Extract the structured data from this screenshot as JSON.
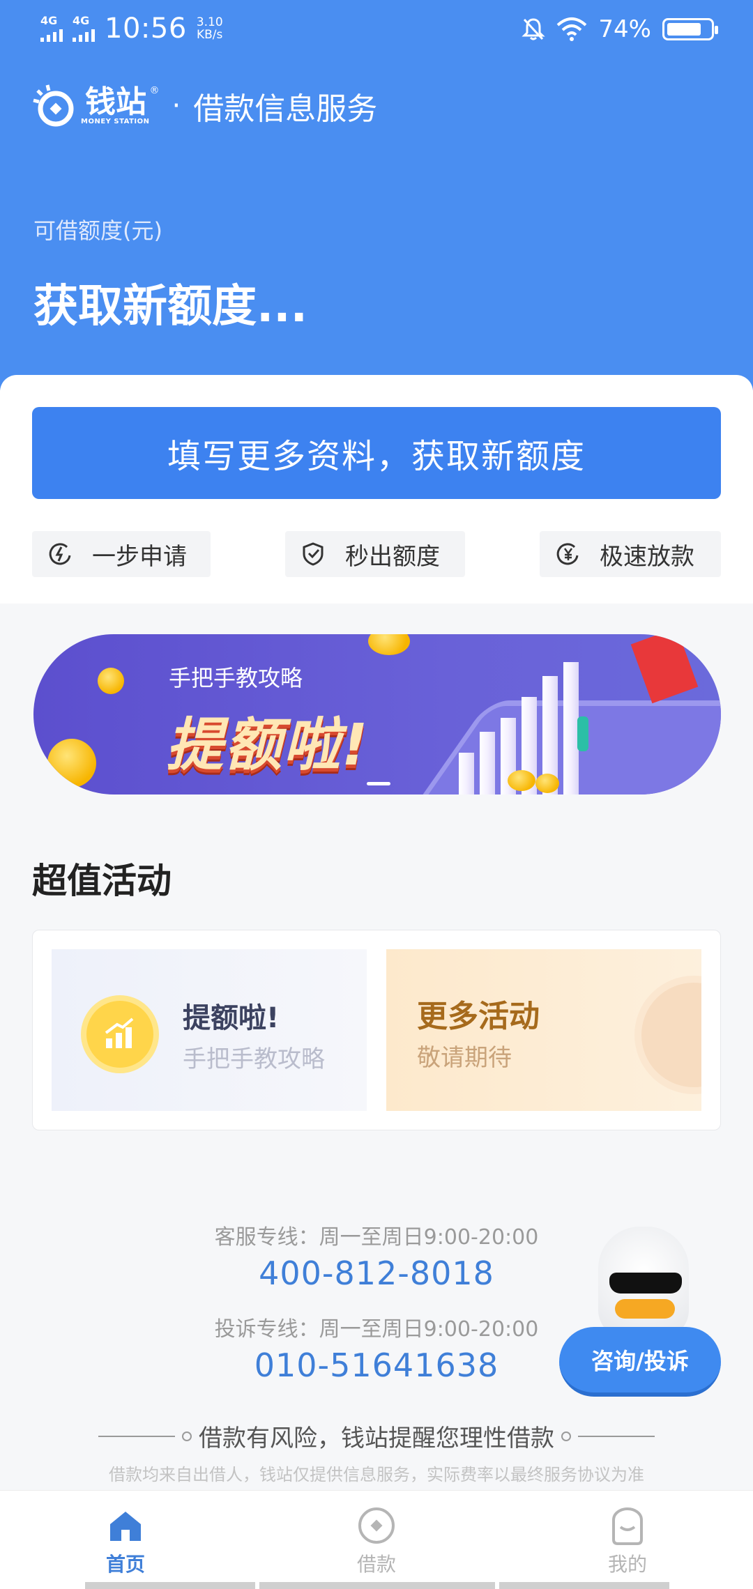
{
  "status_bar": {
    "net1": "4G",
    "net2": "4G",
    "time": "10:56",
    "speed_value": "3.10",
    "speed_unit": "KB/s",
    "battery": "74%",
    "battery_level": 0.74
  },
  "header": {
    "brand_name": "钱站",
    "brand_sub": "MONEY STATION",
    "brand_reg": "®",
    "separator": "·",
    "title": "借款信息服务",
    "quota_label": "可借额度(元)",
    "quota_value": "获取新额度..."
  },
  "main_button": "填写更多资料，获取新额度",
  "features": [
    {
      "label": "一步申请",
      "icon": "lightning-circle-icon"
    },
    {
      "label": "秒出额度",
      "icon": "check-shield-icon"
    },
    {
      "label": "极速放款",
      "icon": "yuan-circle-icon"
    }
  ],
  "banner": {
    "subtitle": "手把手教攻略",
    "title": "提额啦!"
  },
  "activities": {
    "title": "超值活动",
    "items": [
      {
        "title": "提额啦!",
        "subtitle": "手把手教攻略"
      },
      {
        "title": "更多活动",
        "subtitle": "敬请期待"
      }
    ]
  },
  "service": {
    "line1_label": "客服专线：周一至周日9:00-20:00",
    "line1_number": "400-812-8018",
    "line2_label": "投诉专线：周一至周日9:00-20:00",
    "line2_number": "010-51641638",
    "risk_notice": "借款有风险，钱站提醒您理性借款",
    "disclaimer": "借款均来自出借人，钱站仅提供信息服务，实际费率以最终服务协议为准"
  },
  "mascot": {
    "label": "咨询/投诉"
  },
  "tabbar": [
    {
      "label": "首页",
      "active": true
    },
    {
      "label": "借款",
      "active": false
    },
    {
      "label": "我的",
      "active": false
    }
  ],
  "colors": {
    "primary": "#4a8ef1",
    "button": "#3d82f0",
    "link": "#3f7fd8"
  }
}
